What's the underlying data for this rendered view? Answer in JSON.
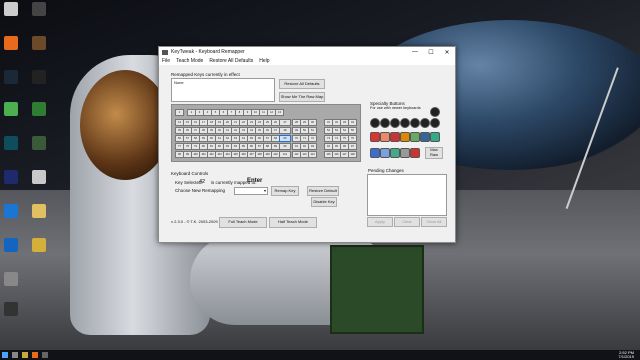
{
  "desktop": {
    "icons": [
      {
        "label": "",
        "color": "#cccccc"
      },
      {
        "label": "",
        "color": "#444444"
      },
      {
        "label": "",
        "color": "#e86a1c"
      },
      {
        "label": "",
        "color": "#6b4a2a"
      },
      {
        "label": "",
        "color": "#1b2838"
      },
      {
        "label": "",
        "color": "#222222"
      },
      {
        "label": "",
        "color": "#4caf50"
      },
      {
        "label": "",
        "color": "#2e7d32"
      },
      {
        "label": "",
        "color": "#0f4c5c"
      },
      {
        "label": "",
        "color": "#3a5a3a"
      },
      {
        "label": "",
        "color": "#1e2a6b"
      },
      {
        "label": "",
        "color": "#c9c9c9"
      },
      {
        "label": "",
        "color": "#1976d2"
      },
      {
        "label": "",
        "color": "#e0c060"
      },
      {
        "label": "",
        "color": "#1565c0"
      },
      {
        "label": "",
        "color": "#d4b03a"
      },
      {
        "label": "",
        "color": "#888888"
      },
      {
        "label": "",
        "color": "#333333"
      }
    ]
  },
  "window": {
    "title": "KeyTweak -  Keyboard Remapper",
    "controls": [
      "—",
      "☐",
      "✕"
    ],
    "menu": [
      "File",
      "Teach Mode",
      "Restore All Defaults",
      "Help"
    ],
    "remapped_label": "Remapped Keys currently in effect",
    "remapped_value": "None",
    "restore_all_defaults": "Restore All Defaults",
    "show_raw_map": "Show Me The Raw Map",
    "keyboard_controls_label": "Keyboard Controls",
    "key_selected_label": "Key Selected:",
    "key_selected_value": "42",
    "mapped_to_label": "is currently mapped to:",
    "mapped_to_value": "Enter",
    "choose_remap_label": "Choose New Remapping",
    "choose_remap_value": "",
    "remap_key": "Remap Key",
    "restore_default": "Restore Default",
    "disable_key": "Disable Key",
    "version": "v 2.3.0 - © T.K. 2003-2009",
    "full_teach_mode": "Full Teach Mode",
    "half_teach_mode": "Half Teach Mode",
    "special_buttons_title": "Specialty Buttons",
    "special_buttons_sub": "For use with newer keyboards",
    "max_label": "Max",
    "raw_label": "Raw",
    "pending_label": "Pending Changes",
    "apply": "Apply",
    "clear": "Clear",
    "clear_all": "Clear All"
  },
  "taskbar": {
    "time": "2:52 PM",
    "date": "7/1/2019"
  }
}
